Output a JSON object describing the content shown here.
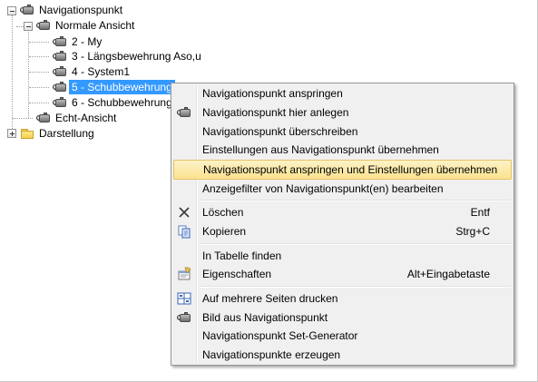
{
  "tree": {
    "root": {
      "label": "Navigationspunkt",
      "icon": "camera-icon",
      "expander": "minus"
    },
    "group": {
      "label": "Normale Ansicht",
      "icon": "camera-icon",
      "expander": "minus"
    },
    "children": [
      {
        "label": "2 - My",
        "icon": "camera-icon"
      },
      {
        "label": "3 - Längsbewehrung Aso,u",
        "icon": "camera-icon"
      },
      {
        "label": "4 - System1",
        "icon": "camera-icon"
      },
      {
        "label": "5 - Schubbewehrung",
        "icon": "camera-icon",
        "selected": true
      },
      {
        "label": "6 - Schubbewehrung",
        "icon": "camera-icon"
      }
    ],
    "echt": {
      "label": "Echt-Ansicht",
      "icon": "camera-icon"
    },
    "darstellung": {
      "label": "Darstellung",
      "icon": "folder-icon",
      "expander": "plus"
    }
  },
  "menu": {
    "items": [
      {
        "label": "Navigationspunkt anspringen",
        "icon": "",
        "shortcut": ""
      },
      {
        "label": "Navigationspunkt hier anlegen",
        "icon": "camera-icon",
        "shortcut": ""
      },
      {
        "label": "Navigationspunkt überschreiben",
        "icon": "",
        "shortcut": ""
      },
      {
        "label": "Einstellungen aus Navigationspunkt übernehmen",
        "icon": "",
        "shortcut": ""
      },
      {
        "label": "Navigationspunkt anspringen und Einstellungen übernehmen",
        "icon": "",
        "shortcut": "",
        "highlighted": true
      },
      {
        "label": "Anzeigefilter von Navigationspunkt(en) bearbeiten",
        "icon": "",
        "shortcut": ""
      },
      {
        "label": "Löschen",
        "icon": "delete-x-icon",
        "shortcut": "Entf"
      },
      {
        "label": "Kopieren",
        "icon": "copy-icon",
        "shortcut": "Strg+C"
      },
      {
        "label": "In Tabelle finden",
        "icon": "",
        "shortcut": ""
      },
      {
        "label": "Eigenschaften",
        "icon": "properties-icon",
        "shortcut": "Alt+Eingabetaste"
      },
      {
        "label": "Auf mehrere Seiten drucken",
        "icon": "multi-page-print-icon",
        "shortcut": ""
      },
      {
        "label": "Bild aus Navigationspunkt",
        "icon": "camera-icon",
        "shortcut": ""
      },
      {
        "label": "Navigationspunkt Set-Generator",
        "icon": "",
        "shortcut": ""
      },
      {
        "label": "Navigationspunkte erzeugen",
        "icon": "",
        "shortcut": ""
      }
    ]
  },
  "colors": {
    "selection": "#3399ff",
    "menu_background": "#f0f0f0",
    "menu_highlight": "#fbe28f",
    "menu_highlight_border": "#e5c365"
  }
}
